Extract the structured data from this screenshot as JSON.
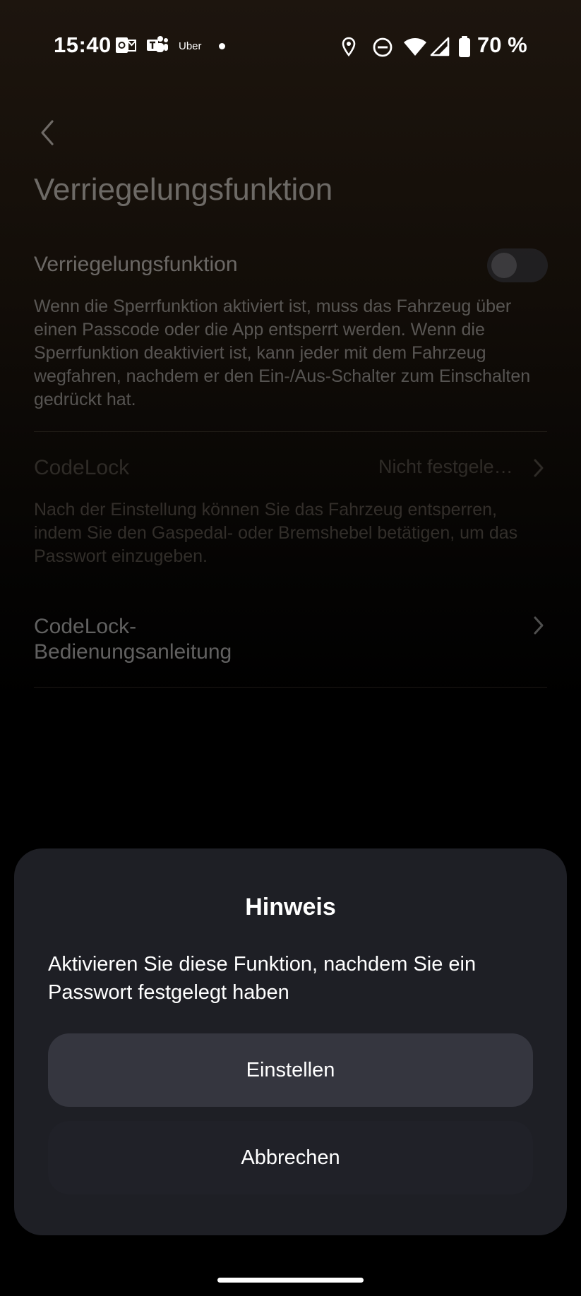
{
  "status_bar": {
    "time": "15:40",
    "notification_icons": [
      "outlook-icon",
      "teams-icon",
      "uber-icon"
    ],
    "uber_label": "Uber",
    "system_icons": [
      "location-icon",
      "dnd-icon",
      "wifi-icon",
      "signal-icon",
      "battery-icon"
    ],
    "battery_percent": "70 %"
  },
  "page": {
    "title": "Verriegelungsfunktion",
    "lock_setting": {
      "label": "Verriegelungsfunktion",
      "enabled": false,
      "description": "Wenn die Sperrfunktion aktiviert ist, muss das Fahrzeug über einen Passcode oder die App entsperrt werden. Wenn die Sperrfunktion deaktiviert ist, kann jeder mit dem Fahrzeug wegfahren, nachdem er den Ein-/Aus-Schalter zum Einschalten gedrückt hat."
    },
    "codelock": {
      "label": "CodeLock",
      "value": "Nicht festgele…",
      "description": "Nach der Einstellung können Sie das Fahrzeug entsperren, indem Sie den Gaspedal- oder Bremshebel betätigen, um das Passwort einzugeben."
    },
    "guide": {
      "label": "CodeLock-Bedienungsanleitung"
    }
  },
  "dialog": {
    "title": "Hinweis",
    "message": "Aktivieren Sie diese Funktion, nachdem Sie ein Passwort festgelegt haben",
    "confirm_label": "Einstellen",
    "cancel_label": "Abbrechen"
  }
}
